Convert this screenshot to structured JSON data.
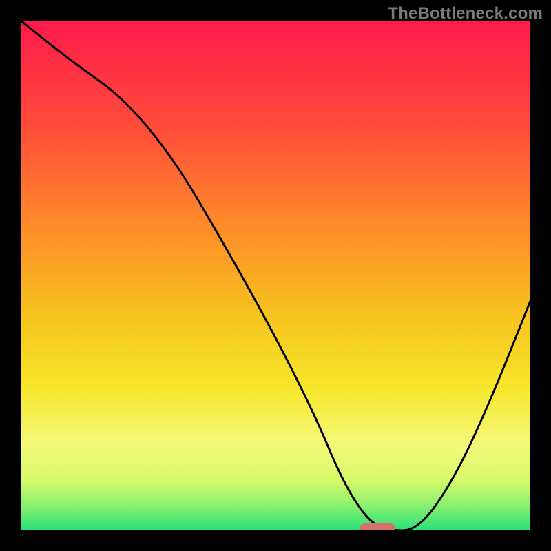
{
  "watermark": "TheBottleneck.com",
  "chart_data": {
    "type": "line",
    "title": "",
    "xlabel": "",
    "ylabel": "",
    "xlim": [
      0,
      100
    ],
    "ylim": [
      0,
      100
    ],
    "x": [
      0,
      10,
      20,
      30,
      40,
      50,
      58,
      63,
      68,
      72,
      78,
      85,
      92,
      100
    ],
    "values": [
      100,
      92,
      85,
      73,
      56,
      38,
      22,
      10,
      2,
      0,
      0,
      10,
      25,
      45
    ],
    "optimum_marker": {
      "x_center": 70,
      "y": 0,
      "width": 7,
      "height": 2.2
    },
    "gradient_stops": [
      {
        "offset": 0.0,
        "color": "#ff1a4b"
      },
      {
        "offset": 0.2,
        "color": "#ff4a3a"
      },
      {
        "offset": 0.4,
        "color": "#ff8a2a"
      },
      {
        "offset": 0.58,
        "color": "#f6c31e"
      },
      {
        "offset": 0.72,
        "color": "#f7e62a"
      },
      {
        "offset": 0.83,
        "color": "#f4f97a"
      },
      {
        "offset": 0.9,
        "color": "#d9f96a"
      },
      {
        "offset": 0.95,
        "color": "#8cf06e"
      },
      {
        "offset": 1.0,
        "color": "#29e07a"
      }
    ],
    "marker_color": "#d6706b",
    "curve_color": "#000000"
  }
}
